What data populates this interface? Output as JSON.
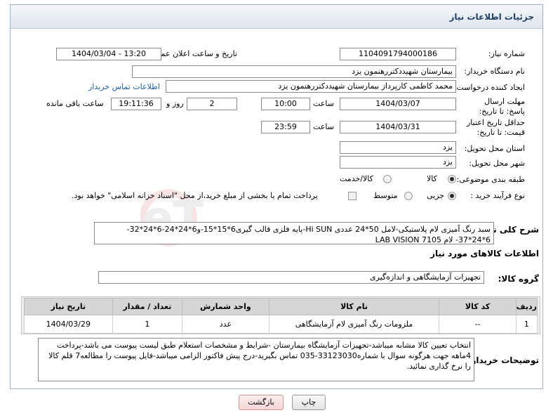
{
  "header": {
    "title": "جزئیات اطلاعات نیاز"
  },
  "fields": {
    "need_number_label": "شماره نیاز:",
    "need_number": "1104091794000186",
    "announce_label": "تاریخ و ساعت اعلان عمومی:",
    "announce_value": "1404/03/04 - 13:20",
    "buyer_org_label": "نام دستگاه خریدار:",
    "buyer_org": "بیمارستان شهیددکتررهنمون یزد",
    "creator_label": "ایجاد کننده درخواست:",
    "creator": "محمد کاظمی کارپرداز بیمارستان شهیددکتررهنمون یزد",
    "contact_link": "اطلاعات تماس خریدار",
    "reply_deadline_label": "مهلت ارسال پاسخ: تا تاریخ:",
    "reply_date": "1404/03/07",
    "time_label": "ساعت",
    "reply_time": "10:00",
    "days_value": "2",
    "days_label": "روز و",
    "remaining_time": "19:11:36",
    "remaining_label": "ساعت باقی مانده",
    "price_validity_label": "حداقل تاریخ اعتبار قیمت: تا تاریخ:",
    "price_date": "1404/03/31",
    "price_time": "23:59",
    "province_label": "استان محل تحویل:",
    "province": "یزد",
    "city_label": "شهر محل تحویل:",
    "city": "یزد",
    "category_label": "طبقه بندی موضوعی:",
    "category_options": [
      "کالا",
      "کالا/خدمت"
    ],
    "process_label": "نوع فرآیند خرید :",
    "process_options": [
      "جزیی",
      "متوسط"
    ],
    "payment_note": "پرداخت تمام یا بخشی از مبلغ خرید،از محل \"اسناد خزانه اسلامی\" خواهد بود.",
    "general_desc_label": "شرح کلی نیاز:",
    "general_desc": "سبد رنگ آمیزی لام پلاستیکی-لامل 50*24 عددی Hi SUN-پایه فلزی قالب گیری6*15*15-و6*24*24-6*24*32-6*24*37- لام LAB VISION 7105",
    "goods_info_title": "اطلاعات کالاهای مورد نیاز",
    "goods_group_label": "گروه کالا:",
    "goods_group": "تجهیزات آزمایشگاهی و اندازه‌گیری",
    "buyer_notes_label": "توضیحات خریدار:",
    "buyer_notes": "انتخاب تعیین کالا مشابه میباشد-تجهیزات آزمایشگاه بیمارستان -شرایط و مشخصات استعلام طبق لیست پیوست می باشد-پرداخت 4ماهه جهت هرگونه سوال با شماره33123030-035 تماس بگیرید-درج پیش فاکتور الزامی میباشد-فایل پیوست را مطالعه7 قلم کالا را نرخ گذاری نمائید."
  },
  "table": {
    "headers": [
      "ردیف",
      "کد کالا",
      "نام کالا",
      "واحد شمارش",
      "تعداد / مقدار",
      "تاریخ نیاز"
    ],
    "rows": [
      [
        "1",
        "--",
        "ملزومات رنگ آمیزی لام آزمایشگاهی",
        "عدد",
        "1",
        "1404/03/29"
      ]
    ]
  },
  "buttons": {
    "print": "چاپ",
    "back": "بازگشت"
  },
  "watermark": "AriaTender.neT",
  "colors": {
    "header_text": "#1e3f66",
    "link": "#1a5fb4",
    "table_header": "#d6d6d6"
  }
}
